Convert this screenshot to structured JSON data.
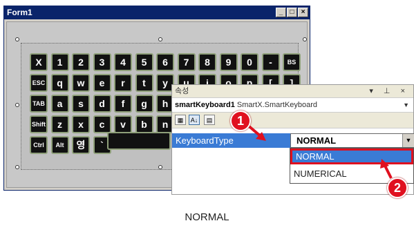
{
  "form": {
    "title": "Form1",
    "window_buttons": [
      "_",
      "□",
      "×"
    ]
  },
  "keyboard": {
    "row1": [
      "X",
      "1",
      "2",
      "3",
      "4",
      "5",
      "6",
      "7",
      "8",
      "9",
      "0",
      "-",
      "BS"
    ],
    "row2": [
      "ESC",
      "q",
      "w",
      "e",
      "r",
      "t",
      "y",
      "u",
      "i",
      "o",
      "p",
      "[",
      "]"
    ],
    "row3": [
      "TAB",
      "a",
      "s",
      "d",
      "f",
      "g",
      "h"
    ],
    "row4": [
      "Shift",
      "z",
      "x",
      "c",
      "v",
      "b",
      "n"
    ],
    "row5": [
      "Ctrl",
      "Alt",
      "영",
      "`"
    ]
  },
  "properties": {
    "title": "속성",
    "header_controls": "▾ ⊥ ×",
    "object_name": "smartKeyboard1",
    "object_type": "SmartX.SmartKeyboard",
    "property_name": "KeyboardType",
    "property_value": "NORMAL",
    "options": [
      "NORMAL",
      "NUMERICAL"
    ]
  },
  "markers": [
    "1",
    "2"
  ],
  "caption": "NORMAL",
  "colors": {
    "accent": "#3a7bd5",
    "marker": "#e0101f",
    "titlebar": "#0a246a"
  }
}
